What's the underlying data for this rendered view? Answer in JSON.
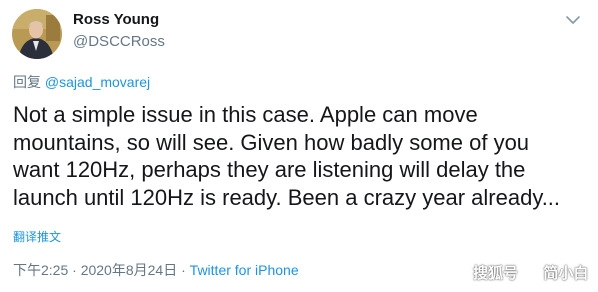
{
  "author": {
    "name": "Ross Young",
    "handle": "@DSCCRoss"
  },
  "reply_context": {
    "prefix": "回复",
    "mention": "@sajad_movarej"
  },
  "tweet": {
    "lines": [
      "Not a simple issue in this case. Apple can move",
      "mountains, so will see. Given how badly some of you",
      "want 120Hz, perhaps they are listening will delay the",
      "launch until 120Hz is ready. Been a crazy year already..."
    ],
    "translate_label": "翻译推文"
  },
  "meta": {
    "time": "下午2:25",
    "separator": "·",
    "date": "2020年8月24日",
    "app": "Twitter for iPhone"
  },
  "watermark": {
    "left_text": "搜狐号",
    "right_text": "简小白"
  },
  "colors": {
    "link": "#1b95e0",
    "secondary": "#657786",
    "text": "#14171a"
  },
  "icons": {
    "caret": "chevron-down-icon"
  }
}
